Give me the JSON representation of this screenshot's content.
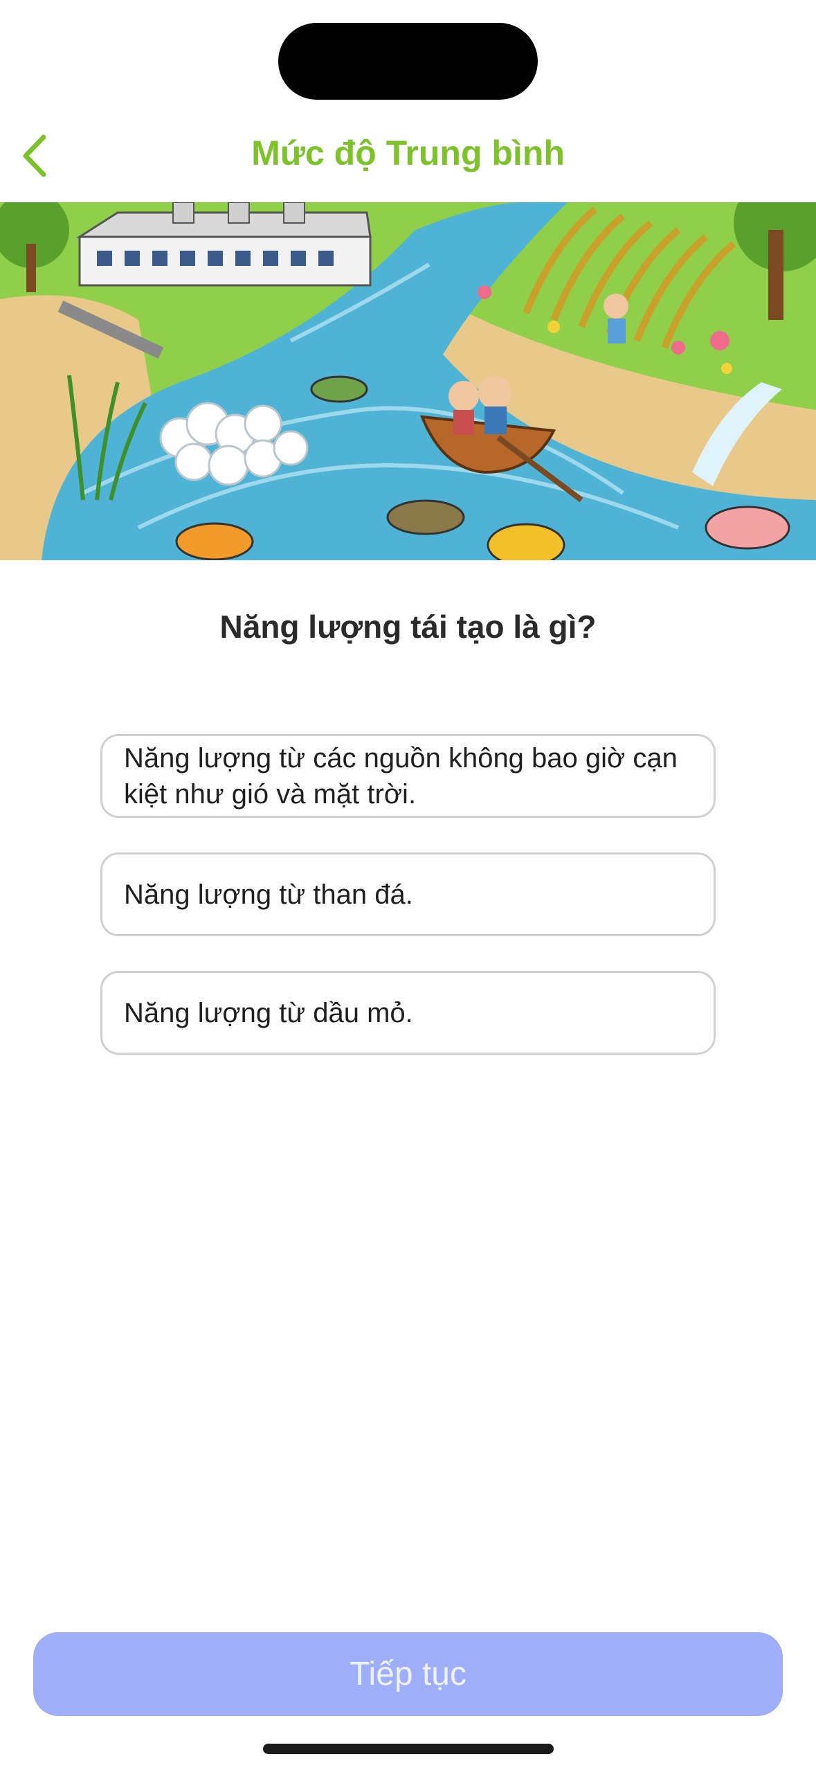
{
  "header": {
    "title": "Mức độ Trung bình",
    "back_icon": "chevron-left-icon"
  },
  "hero_image": {
    "description_icon": "illustration-river-pollution",
    "colors": {
      "water": "#4fb3d6",
      "grass": "#7cc43a",
      "sand": "#e9c98a"
    }
  },
  "quiz": {
    "question": "Năng lượng tái tạo là gì?",
    "options": [
      {
        "label": "Năng lượng từ các nguồn không bao giờ cạn kiệt như gió và mặt trời."
      },
      {
        "label": "Năng lượng từ than đá."
      },
      {
        "label": "Năng lượng từ dầu mỏ."
      }
    ]
  },
  "footer": {
    "continue_label": "Tiếp tục"
  },
  "theme": {
    "accent": "#7dc22a",
    "button_disabled": "#9eaef8",
    "option_border": "#d0d0d0"
  }
}
